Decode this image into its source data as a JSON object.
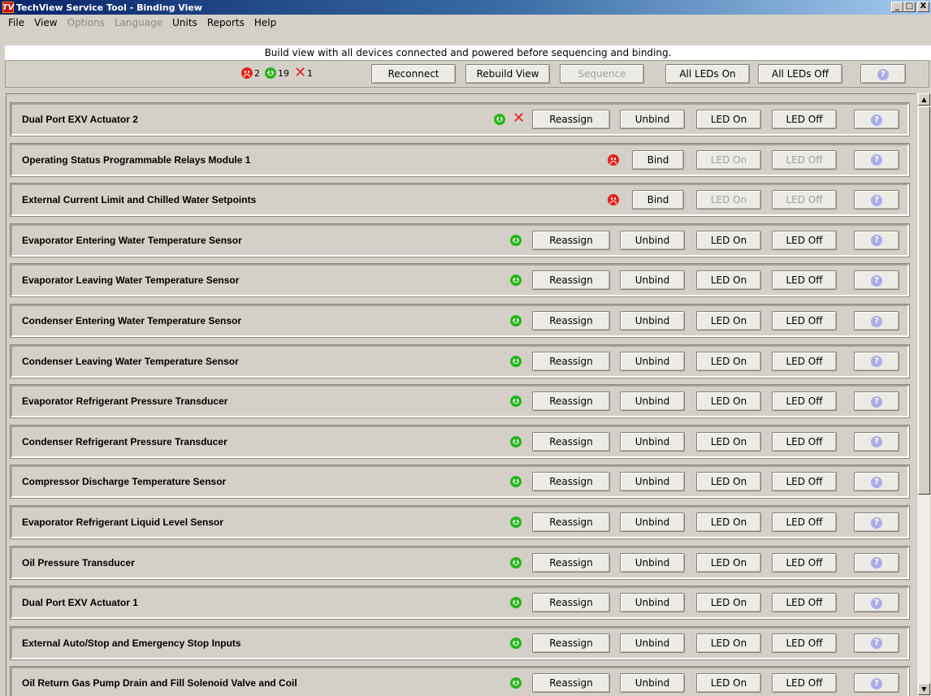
{
  "window": {
    "title": "TechView Service Tool - Binding View",
    "logo": "TV"
  },
  "window_controls": {
    "minimize": "_",
    "maximize": "□",
    "close": "X"
  },
  "menu": [
    {
      "label": "File",
      "disabled": false
    },
    {
      "label": "View",
      "disabled": false
    },
    {
      "label": "Options",
      "disabled": true
    },
    {
      "label": "Language",
      "disabled": true
    },
    {
      "label": "Units",
      "disabled": false
    },
    {
      "label": "Reports",
      "disabled": false
    },
    {
      "label": "Help",
      "disabled": false
    }
  ],
  "info_message": "Build view with all devices connected and powered before sequencing and binding.",
  "status_counts": {
    "unbound": "2",
    "bound": "19",
    "missing": "1"
  },
  "toolbar": {
    "reconnect": "Reconnect",
    "rebuild_view": "Rebuild View",
    "sequence": "Sequence",
    "all_leds_on": "All LEDs On",
    "all_leds_off": "All LEDs Off",
    "help": "?"
  },
  "labels": {
    "reassign": "Reassign",
    "unbind": "Unbind",
    "bind": "Bind",
    "led_on": "LED On",
    "led_off": "LED Off",
    "help": "?"
  },
  "colors": {
    "bound": "#26b51b",
    "unbound": "#e5221a",
    "missing": "#e5221a",
    "help": "#a8aee8"
  },
  "devices": [
    {
      "name": "Dual Port EXV Actuator 2",
      "status": "bound",
      "missing": true
    },
    {
      "name": "Operating Status Programmable Relays Module 1",
      "status": "unbound",
      "missing": false
    },
    {
      "name": "External Current Limit and Chilled Water Setpoints",
      "status": "unbound",
      "missing": false
    },
    {
      "name": "Evaporator Entering Water Temperature Sensor",
      "status": "bound",
      "missing": false
    },
    {
      "name": "Evaporator Leaving Water Temperature Sensor",
      "status": "bound",
      "missing": false
    },
    {
      "name": "Condenser Entering Water Temperature Sensor",
      "status": "bound",
      "missing": false
    },
    {
      "name": "Condenser Leaving Water Temperature Sensor",
      "status": "bound",
      "missing": false
    },
    {
      "name": "Evaporator Refrigerant Pressure Transducer",
      "status": "bound",
      "missing": false
    },
    {
      "name": "Condenser Refrigerant Pressure Transducer",
      "status": "bound",
      "missing": false
    },
    {
      "name": "Compressor Discharge Temperature Sensor",
      "status": "bound",
      "missing": false
    },
    {
      "name": "Evaporator Refrigerant Liquid Level Sensor",
      "status": "bound",
      "missing": false
    },
    {
      "name": "Oil Pressure Transducer",
      "status": "bound",
      "missing": false
    },
    {
      "name": "Dual Port EXV Actuator 1",
      "status": "bound",
      "missing": false
    },
    {
      "name": "External Auto/Stop and Emergency Stop Inputs",
      "status": "bound",
      "missing": false
    },
    {
      "name": "Oil Return Gas Pump Drain and Fill Solenoid Valve and Coil",
      "status": "bound",
      "missing": false
    }
  ]
}
